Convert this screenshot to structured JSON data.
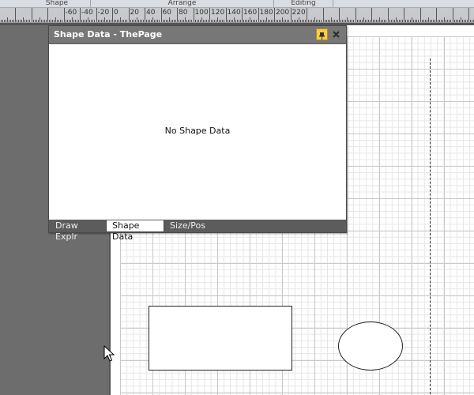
{
  "ribbon": {
    "groups": [
      "Shape",
      "Arrange",
      "Editing"
    ]
  },
  "ruler": {
    "labels": [
      "-60",
      "-40",
      "-20",
      "0",
      "20",
      "40",
      "60",
      "80",
      "100",
      "120",
      "140",
      "160",
      "180",
      "200",
      "220"
    ]
  },
  "shape_data_window": {
    "title": "Shape Data - ThePage",
    "empty_message": "No Shape Data",
    "tabs": [
      {
        "label": "Draw Explr",
        "active": false
      },
      {
        "label": "Shape Data",
        "active": true
      },
      {
        "label": "Size/Pos",
        "active": false
      }
    ]
  },
  "colors": {
    "pin_button": "#f7cd4b",
    "title_bar": "#777777",
    "canvas": "#6d6d6d"
  },
  "icons": [
    "pin-icon",
    "close-icon",
    "mouse-pointer-icon"
  ]
}
